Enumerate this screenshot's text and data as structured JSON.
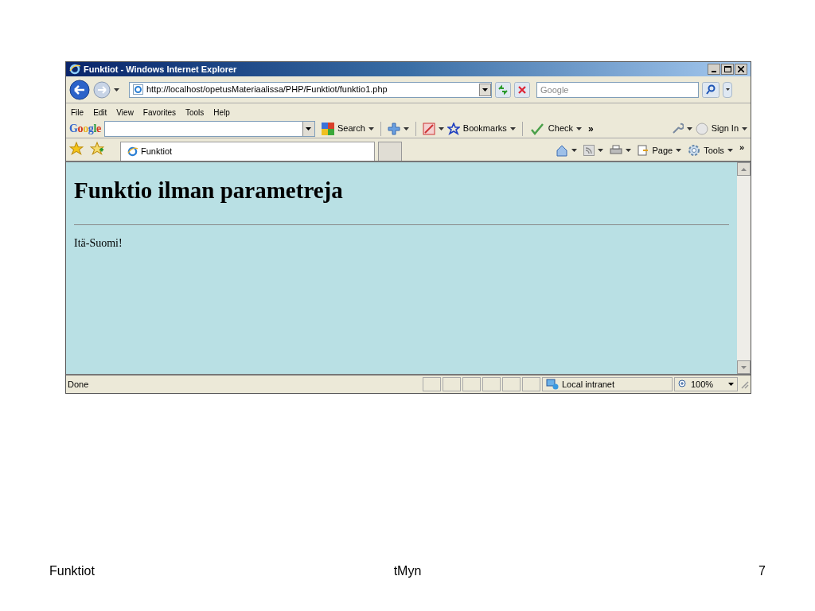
{
  "window": {
    "title": "Funktiot - Windows Internet Explorer"
  },
  "address": {
    "url": "http://localhost/opetusMateriaalissa/PHP/Funktiot/funktio1.php"
  },
  "search": {
    "placeholder": "Google"
  },
  "menu": [
    "File",
    "Edit",
    "View",
    "Favorites",
    "Tools",
    "Help"
  ],
  "google_toolbar": {
    "logo": "Google",
    "search_label": "Search",
    "bookmarks_label": "Bookmarks",
    "check_label": "Check",
    "more": "»",
    "sign_in": "Sign In"
  },
  "tabs": [
    {
      "label": "Funktiot",
      "selected": true
    }
  ],
  "command_bar": {
    "page": "Page",
    "tools": "Tools",
    "more": "»"
  },
  "page": {
    "heading": "Funktio ilman parametreja",
    "text": "Itä-Suomi!"
  },
  "status_bar": {
    "status": "Done",
    "zone": "Local intranet",
    "zoom": "100%"
  },
  "slide_footer": {
    "left": "Funktiot",
    "center": "tMyn",
    "page_number": "7"
  }
}
